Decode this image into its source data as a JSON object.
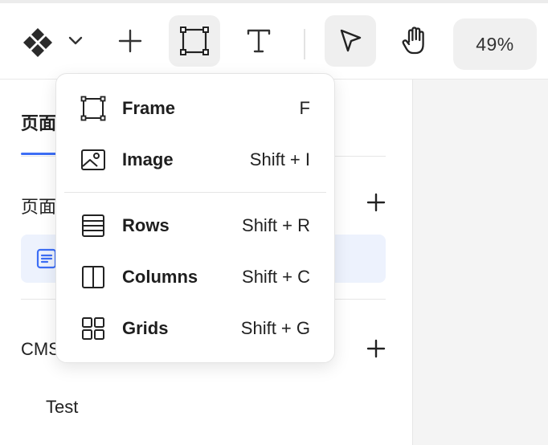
{
  "toolbar": {
    "zoom": "49%"
  },
  "sidebar": {
    "tab_label": "页面",
    "pages_label": "页面",
    "cms_label": "CMS",
    "cms_item": "Test"
  },
  "insert_menu": {
    "items": [
      {
        "label": "Frame",
        "shortcut": "F",
        "icon": "frame-icon"
      },
      {
        "label": "Image",
        "shortcut": "Shift + I",
        "icon": "image-icon"
      },
      {
        "label": "Rows",
        "shortcut": "Shift + R",
        "icon": "rows-icon"
      },
      {
        "label": "Columns",
        "shortcut": "Shift + C",
        "icon": "columns-icon"
      },
      {
        "label": "Grids",
        "shortcut": "Shift + G",
        "icon": "grids-icon"
      }
    ]
  },
  "colors": {
    "accent": "#3d6ef5",
    "selected_row": "#edf2fd",
    "canvas": "#f4f4f4"
  }
}
